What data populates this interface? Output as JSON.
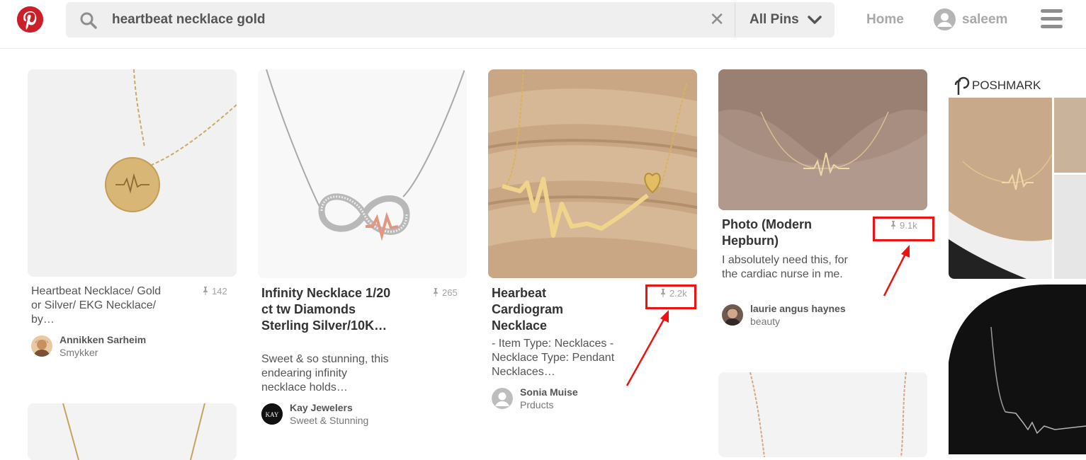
{
  "header": {
    "search_query": "heartbeat necklace gold",
    "filter_label": "All Pins",
    "home_label": "Home",
    "username": "saleem"
  },
  "brand_color": "#cb2027",
  "annotation_color": "#ee1111",
  "pins": [
    {
      "title": "Heartbeat Necklace/ Gold or Silver/ EKG Necklace/ by…",
      "saves": "142",
      "creator": "Annikken Sarheim",
      "board": "Smykker"
    },
    {
      "title": "Infinity Necklace 1/20 ct tw Diamonds Sterling Silver/10K…",
      "description": "Sweet & so stunning, this endearing infinity necklace holds…",
      "saves": "265",
      "creator": "Kay Jewelers",
      "board": "Sweet & Stunning",
      "avatar_text": "KAY"
    },
    {
      "title": "Hearbeat Cardiogram Necklace",
      "description": "- Item Type: Necklaces - Necklace Type: Pendant Necklaces…",
      "saves": "2.2k",
      "creator": "Sonia Muise",
      "board": "Prducts"
    },
    {
      "title": "Photo (Modern Hepburn)",
      "description": "I absolutely need this, for the cardiac nurse in me.",
      "saves": "9.1k",
      "creator": "laurie angus haynes",
      "board": "beauty"
    },
    {
      "brand_watermark": "POSHMARK"
    }
  ]
}
